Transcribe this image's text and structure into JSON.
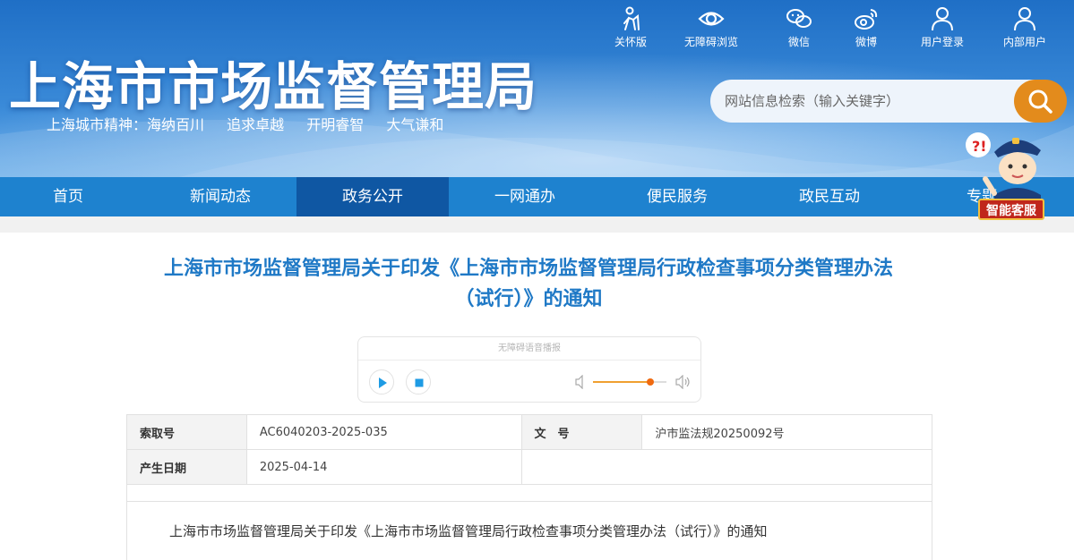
{
  "header": {
    "title": "上海市市场监督管理局",
    "slogan": [
      "上海城市精神：海纳百川",
      "追求卓越",
      "开明睿智",
      "大气谦和"
    ],
    "tools": [
      {
        "label": "关怀版",
        "icon": "elderly-care-icon"
      },
      {
        "label": "无障碍浏览",
        "icon": "eye-icon"
      },
      {
        "label": "微信",
        "icon": "wechat-icon"
      },
      {
        "label": "微博",
        "icon": "weibo-icon"
      },
      {
        "label": "用户登录",
        "icon": "user-icon"
      },
      {
        "label": "内部用户",
        "icon": "user-icon"
      }
    ],
    "search": {
      "placeholder": "网站信息检索（输入关键字）"
    }
  },
  "nav": {
    "items": [
      "首页",
      "新闻动态",
      "政务公开",
      "一网通办",
      "便民服务",
      "政民互动",
      "专题"
    ],
    "active_index": 2
  },
  "mascot": {
    "label": "智能客服"
  },
  "article": {
    "title_line1": "上海市市场监督管理局关于印发《上海市市场监督管理局行政检查事项分类管理办法",
    "title_line2": "（试行）》的通知",
    "player": {
      "title": "无障碍语音播报",
      "volume": 0.78
    },
    "meta": {
      "index_label": "索取号",
      "index_value": "AC6040203-2025-035",
      "doc_no_label": "文　号",
      "doc_no_value": "沪市监法规20250092号",
      "date_label": "产生日期",
      "date_value": "2025-04-14"
    },
    "body_first_line": "上海市市场监督管理局关于印发《上海市市场监督管理局行政检查事项分类管理办法（试行）》的通知"
  },
  "colors": {
    "header_blue": "#2a7bd0",
    "nav_blue": "#1e82cf",
    "nav_active": "#0f57a3",
    "search_orange": "#e38b1c",
    "title_blue": "#1f79c6"
  }
}
